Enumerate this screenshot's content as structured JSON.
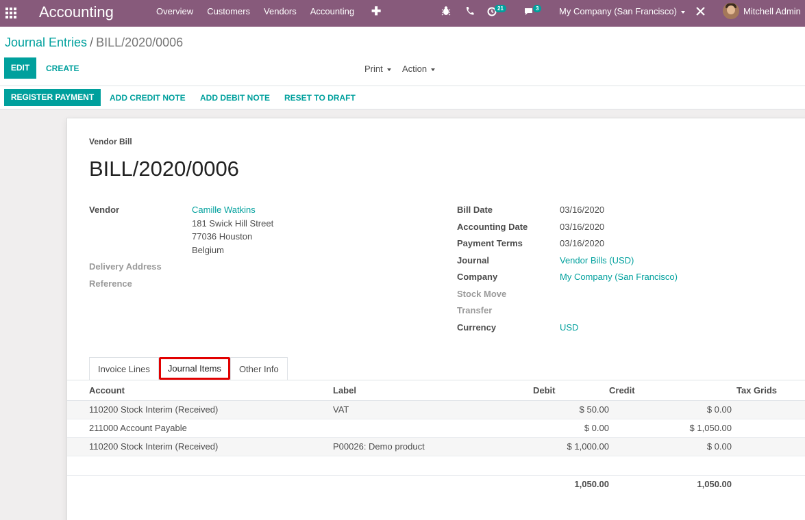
{
  "navbar": {
    "app_title": "Accounting",
    "menu": [
      "Overview",
      "Customers",
      "Vendors",
      "Accounting"
    ],
    "activity_count": "21",
    "messages_count": "3",
    "company": "My Company (San Francisco)",
    "user": "Mitchell Admin"
  },
  "breadcrumb": {
    "parent": "Journal Entries",
    "separator": "/",
    "current": "BILL/2020/0006"
  },
  "control": {
    "edit": "EDIT",
    "create": "CREATE",
    "print": "Print",
    "action": "Action"
  },
  "status_buttons": {
    "register_payment": "REGISTER PAYMENT",
    "add_credit_note": "ADD CREDIT NOTE",
    "add_debit_note": "ADD DEBIT NOTE",
    "reset_to_draft": "RESET TO DRAFT"
  },
  "form": {
    "doc_type": "Vendor Bill",
    "name": "BILL/2020/0006",
    "vendor_label": "Vendor",
    "vendor_name": "Camille Watkins",
    "vendor_address": [
      "181 Swick Hill Street",
      "77036 Houston",
      "Belgium"
    ],
    "delivery_address_label": "Delivery Address",
    "reference_label": "Reference",
    "bill_date_label": "Bill Date",
    "bill_date": "03/16/2020",
    "accounting_date_label": "Accounting Date",
    "accounting_date": "03/16/2020",
    "payment_terms_label": "Payment Terms",
    "payment_terms": "03/16/2020",
    "journal_label": "Journal",
    "journal": "Vendor Bills (USD)",
    "company_label": "Company",
    "company": "My Company (San Francisco)",
    "stock_move_label": "Stock Move",
    "transfer_label": "Transfer",
    "currency_label": "Currency",
    "currency": "USD"
  },
  "tabs": [
    "Invoice Lines",
    "Journal Items",
    "Other Info"
  ],
  "table": {
    "headers": {
      "account": "Account",
      "label": "Label",
      "debit": "Debit",
      "credit": "Credit",
      "tax_grids": "Tax Grids"
    },
    "rows": [
      {
        "account": "110200 Stock Interim (Received)",
        "label": "VAT",
        "debit": "$ 50.00",
        "credit": "$ 0.00"
      },
      {
        "account": "211000 Account Payable",
        "label": "",
        "debit": "$ 0.00",
        "credit": "$ 1,050.00"
      },
      {
        "account": "110200 Stock Interim (Received)",
        "label": "P00026: Demo product",
        "debit": "$ 1,000.00",
        "credit": "$ 0.00"
      }
    ],
    "total_debit": "1,050.00",
    "total_credit": "1,050.00"
  }
}
